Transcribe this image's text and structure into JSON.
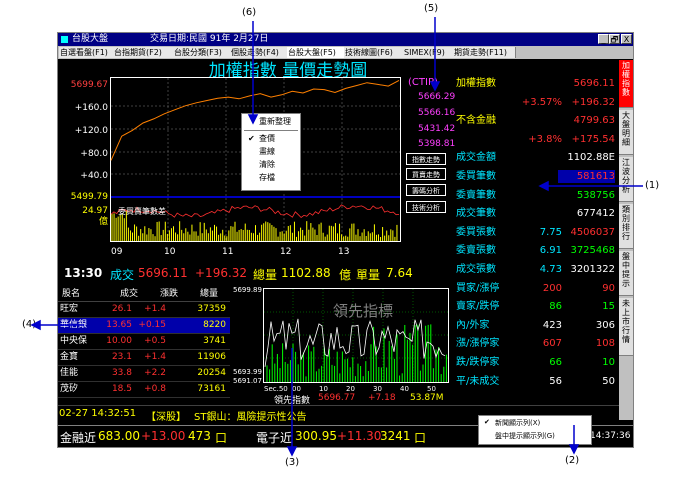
{
  "app": {
    "title": "台股大盤",
    "date_text": "交易日期:民國 91年 2月27日",
    "win_buttons": [
      "_",
      "🗗",
      "X"
    ]
  },
  "tabs": [
    "自選看盤(F1)",
    "台指期貨(F2)",
    "台股分類(F3)",
    "個股走勢(F4)",
    "台股大盤(F5)",
    "技術線圖(F6)",
    "SIMEX(F9)",
    "期貨走勢(F11)"
  ],
  "side_tabs": [
    "加權指數",
    "大盤明細",
    "江波分析",
    "類別排行",
    "盤中提示",
    "未上市行情"
  ],
  "chart": {
    "title": "加權指數 量價走勢圖",
    "price_high": "5699.67",
    "price_low": "5499.79",
    "y_ticks": [
      "+160.0",
      "+120.0",
      "+80.0",
      "+40.0"
    ],
    "volume_top": "24.97",
    "volume_unit": "億",
    "volume_caption": "委買賣筆數差",
    "x_ticks": [
      "09",
      "10",
      "11",
      "12",
      "13"
    ],
    "ctip_label": "(CTIP)",
    "ctip_values": [
      "5666.29",
      "5566.16",
      "5431.42",
      "5398.81"
    ],
    "side_buttons": [
      "指數走勢",
      "買賣走勢",
      "籌碼分析",
      "技術分析"
    ],
    "price_series": [
      5560,
      5602,
      5612,
      5625,
      5632,
      5641,
      5648,
      5655,
      5660,
      5664,
      5668,
      5670,
      5667,
      5672,
      5676,
      5670,
      5674,
      5680,
      5677,
      5684,
      5683,
      5678,
      5685,
      5690,
      5695,
      5692,
      5689,
      5699
    ]
  },
  "context_menu": {
    "items": [
      "重新整理",
      "查價",
      "畫線",
      "清除",
      "存檔"
    ],
    "checked": "查價"
  },
  "status_row": {
    "time": "13:30",
    "trade_label": "成交",
    "trade_value": "5696.11",
    "change": "+196.32",
    "total_label": "總量",
    "total_value": "1102.88",
    "total_unit": "億",
    "single_label": "單量",
    "single_value": "7.64"
  },
  "summary": {
    "rows": [
      {
        "label": "加權指數",
        "a": "",
        "b": "5696.11"
      },
      {
        "label": "",
        "a": "+3.57%",
        "b": "+196.32"
      },
      {
        "label": "不含金融",
        "a": "",
        "b": "4799.63"
      },
      {
        "label": "",
        "a": "+3.8%",
        "b": "+175.54"
      },
      {
        "label": "成交金額",
        "a": "",
        "b": "1102.88E"
      },
      {
        "label": "委買筆數",
        "a": "",
        "b": "581613"
      },
      {
        "label": "委賣筆數",
        "a": "",
        "b": "538756"
      },
      {
        "label": "成交筆數",
        "a": "",
        "b": "677412"
      },
      {
        "label": "委買張數",
        "a": "7.75",
        "b": "4506037"
      },
      {
        "label": "委賣張數",
        "a": "6.91",
        "b": "3725468"
      },
      {
        "label": "成交張數",
        "a": "4.73",
        "b": "3201322"
      },
      {
        "label": "買家/漲停",
        "a": "200",
        "b": "90"
      },
      {
        "label": "賣家/跌停",
        "a": "86",
        "b": "15"
      },
      {
        "label": "內/外家",
        "a": "423",
        "b": "306"
      },
      {
        "label": "漲/漲停家",
        "a": "607",
        "b": "108"
      },
      {
        "label": "跌/跌停家",
        "a": "66",
        "b": "10"
      },
      {
        "label": "平/未成交",
        "a": "56",
        "b": "50"
      }
    ]
  },
  "stock_table": {
    "headers": [
      "股名",
      "成交",
      "漲跌",
      "總量"
    ],
    "rows": [
      {
        "name": "旺宏",
        "price": "26.1",
        "chg": "+1.4",
        "vol": "37359"
      },
      {
        "name": "華信銀",
        "price": "13.65",
        "chg": "+0.15",
        "vol": "8220"
      },
      {
        "name": "中央保",
        "price": "10.00",
        "chg": "+0.5",
        "vol": "3741"
      },
      {
        "name": "金寶",
        "price": "23.1",
        "chg": "+1.4",
        "vol": "11906"
      },
      {
        "name": "佳能",
        "price": "33.8",
        "chg": "+2.2",
        "vol": "20254"
      },
      {
        "name": "茂矽",
        "price": "18.5",
        "chg": "+0.8",
        "vol": "73161"
      }
    ]
  },
  "mini_chart": {
    "high": "5699.89",
    "low1": "5693.99",
    "low2": "5691.07",
    "watermark": "領先指標",
    "x_ticks": [
      "Sec.50",
      "00",
      "10",
      "20",
      "30",
      "40",
      "50"
    ],
    "footer_label": "領先指數",
    "footer_value": "5696.77",
    "footer_change": "+7.18",
    "footer_volume": "53.87M"
  },
  "ticker": {
    "time": "02-27 14:32:51",
    "tag": "【深股】",
    "text": "ST銀山：風險提示性公告"
  },
  "bottom_bar": {
    "left_label": "金融近",
    "left_value": "683.00",
    "left_change": "+13.00",
    "left_vol": "473",
    "left_unit": "口",
    "right_label": "電子近",
    "right_value": "300.95",
    "right_change": "+11.30",
    "right_vol": "3241",
    "right_unit": "口",
    "clock": "14:37:36"
  },
  "popup_menu": {
    "items": [
      "新聞顯示列(X)",
      "盤中提示顯示列(G)"
    ],
    "checked": "新聞顯示列(X)"
  },
  "callouts": [
    "(6)",
    "(5)",
    "(1)",
    "(4)",
    "(3)",
    "(2)"
  ],
  "colors": {
    "accent_red": "#ff2020",
    "accent_yellow": "#ffff00",
    "accent_green": "#00ff00",
    "accent_cyan": "#00e5ff",
    "accent_magenta": "#ff40ff"
  }
}
